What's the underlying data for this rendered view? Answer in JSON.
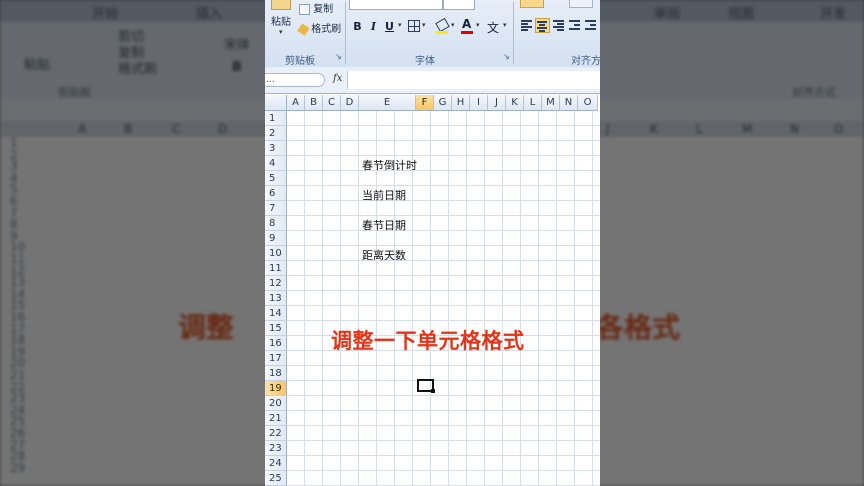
{
  "background": {
    "tabs": [
      "开始",
      "插入",
      "审阅",
      "视图",
      "开发"
    ],
    "clipboard_items": [
      "剪切",
      "复制",
      "格式刷"
    ],
    "paste_label": "粘贴",
    "font_name": "宋体",
    "bold_label": "B",
    "group_labels": [
      "剪贴板",
      "对齐方式"
    ],
    "col_headers": [
      "A",
      "B",
      "C",
      "D",
      "J",
      "K",
      "L",
      "M",
      "N",
      "O"
    ],
    "row_numbers": [
      "1",
      "2",
      "3",
      "4",
      "5",
      "6",
      "7",
      "8",
      "9",
      "10",
      "11",
      "12",
      "13",
      "14",
      "15",
      "16",
      "17",
      "18",
      "19",
      "20",
      "21",
      "22",
      "23",
      "24",
      "25",
      "26",
      "27",
      "28",
      "29"
    ],
    "caption_left": "调整",
    "caption_right": "各格式"
  },
  "ribbon": {
    "paste_label": "粘贴",
    "copy_label": "复制",
    "format_painter_label": "格式刷",
    "clipboard_group": "剪贴板",
    "font_group": "字体",
    "alignment_group": "对齐方式",
    "bold": "B",
    "italic": "I",
    "underline": "U",
    "font_color_glyph": "A",
    "wen_glyph": "文",
    "launcher_glyph": "↘"
  },
  "formula_bar": {
    "name_box": "...",
    "fx_label": "fx",
    "formula": ""
  },
  "sheet": {
    "columns": [
      "A",
      "B",
      "C",
      "D",
      "E",
      "F",
      "G",
      "H",
      "I",
      "J",
      "K",
      "L",
      "M",
      "N",
      "O"
    ],
    "selected_column": "F",
    "rows": [
      "1",
      "2",
      "3",
      "4",
      "5",
      "6",
      "7",
      "8",
      "9",
      "10",
      "11",
      "12",
      "13",
      "14",
      "15",
      "16",
      "17",
      "18",
      "19",
      "20",
      "21",
      "22",
      "23",
      "24",
      "25"
    ],
    "selected_row": "19",
    "cells": [
      {
        "ref": "E4",
        "text": "春节倒计时"
      },
      {
        "ref": "E6",
        "text": "当前日期"
      },
      {
        "ref": "E8",
        "text": "春节日期"
      },
      {
        "ref": "E10",
        "text": "距离天数"
      }
    ]
  },
  "caption": "调整一下单元格格式",
  "colors": {
    "caption": "#e0361a",
    "selection_header": "#f7c564",
    "ribbon": "#d4e1f1"
  }
}
